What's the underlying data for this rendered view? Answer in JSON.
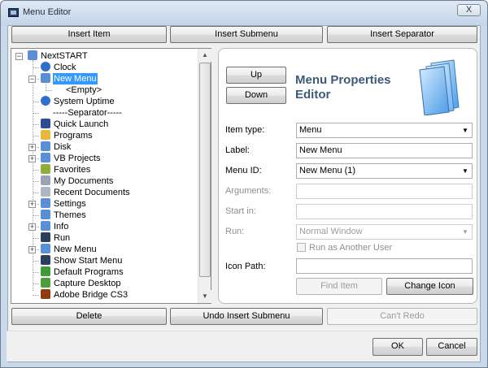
{
  "window": {
    "title": "Menu Editor",
    "close_label": "X"
  },
  "top_buttons": {
    "insert_item": "Insert Item",
    "insert_submenu": "Insert Submenu",
    "insert_separator": "Insert Separator"
  },
  "tree": {
    "items": [
      {
        "label": "NextSTART",
        "icon": "folder-icon",
        "color": "#5a8fd6"
      },
      {
        "label": "Clock",
        "icon": "globe-icon",
        "color": "#2f6fc9"
      },
      {
        "label": "New Menu",
        "icon": "folder-icon",
        "color": "#5a8fd6"
      },
      {
        "label": "<Empty>",
        "icon": "",
        "color": ""
      },
      {
        "label": "System Uptime",
        "icon": "globe-icon",
        "color": "#2f6fc9"
      },
      {
        "label": "-----Separator-----",
        "icon": "",
        "color": ""
      },
      {
        "label": "Quick Launch",
        "icon": "monitor-icon",
        "color": "#2b4f8f"
      },
      {
        "label": "Programs",
        "icon": "folder-open-icon",
        "color": "#e8b83c"
      },
      {
        "label": "Disk",
        "icon": "folder-icon",
        "color": "#5a8fd6"
      },
      {
        "label": "VB Projects",
        "icon": "folder-icon",
        "color": "#5a8fd6"
      },
      {
        "label": "Favorites",
        "icon": "star-icon",
        "color": "#8fae3a"
      },
      {
        "label": "My Documents",
        "icon": "documents-icon",
        "color": "#9aa5b3"
      },
      {
        "label": "Recent Documents",
        "icon": "recent-documents-icon",
        "color": "#b0b7c0"
      },
      {
        "label": "Settings",
        "icon": "folder-icon",
        "color": "#5a8fd6"
      },
      {
        "label": "Themes",
        "icon": "folder-icon",
        "color": "#5a8fd6"
      },
      {
        "label": "Info",
        "icon": "folder-icon",
        "color": "#5a8fd6"
      },
      {
        "label": "Run",
        "icon": "run-icon",
        "color": "#2b3e5a"
      },
      {
        "label": "New Menu",
        "icon": "folder-icon",
        "color": "#5a8fd6"
      },
      {
        "label": "Show Start Menu",
        "icon": "start-menu-icon",
        "color": "#2b3e5a"
      },
      {
        "label": "Default Programs",
        "icon": "default-programs-icon",
        "color": "#3f9b3a"
      },
      {
        "label": "Capture Desktop",
        "icon": "capture-icon",
        "color": "#4e9d3c"
      },
      {
        "label": "Adobe Bridge CS3",
        "icon": "adobe-bridge-icon",
        "color": "#8c3b12"
      }
    ]
  },
  "editor": {
    "up_label": "Up",
    "down_label": "Down",
    "heading": "Menu Properties Editor",
    "item_type": {
      "label": "Item type:",
      "value": "Menu"
    },
    "label": {
      "label": "Label:",
      "value": "New Menu"
    },
    "menu_id": {
      "label": "Menu ID:",
      "value": "New Menu (1)"
    },
    "arguments": {
      "label": "Arguments:",
      "value": ""
    },
    "start_in": {
      "label": "Start in:",
      "value": ""
    },
    "run": {
      "label": "Run:",
      "value": "Normal Window"
    },
    "run_as_other": "Run as Another User",
    "icon_path": {
      "label": "Icon Path:",
      "value": ""
    },
    "find_item_label": "Find Item",
    "change_icon_label": "Change Icon"
  },
  "bottom_buttons": {
    "delete": "Delete",
    "undo": "Undo Insert Submenu",
    "redo": "Can't Redo"
  },
  "dialog": {
    "ok": "OK",
    "cancel": "Cancel"
  }
}
